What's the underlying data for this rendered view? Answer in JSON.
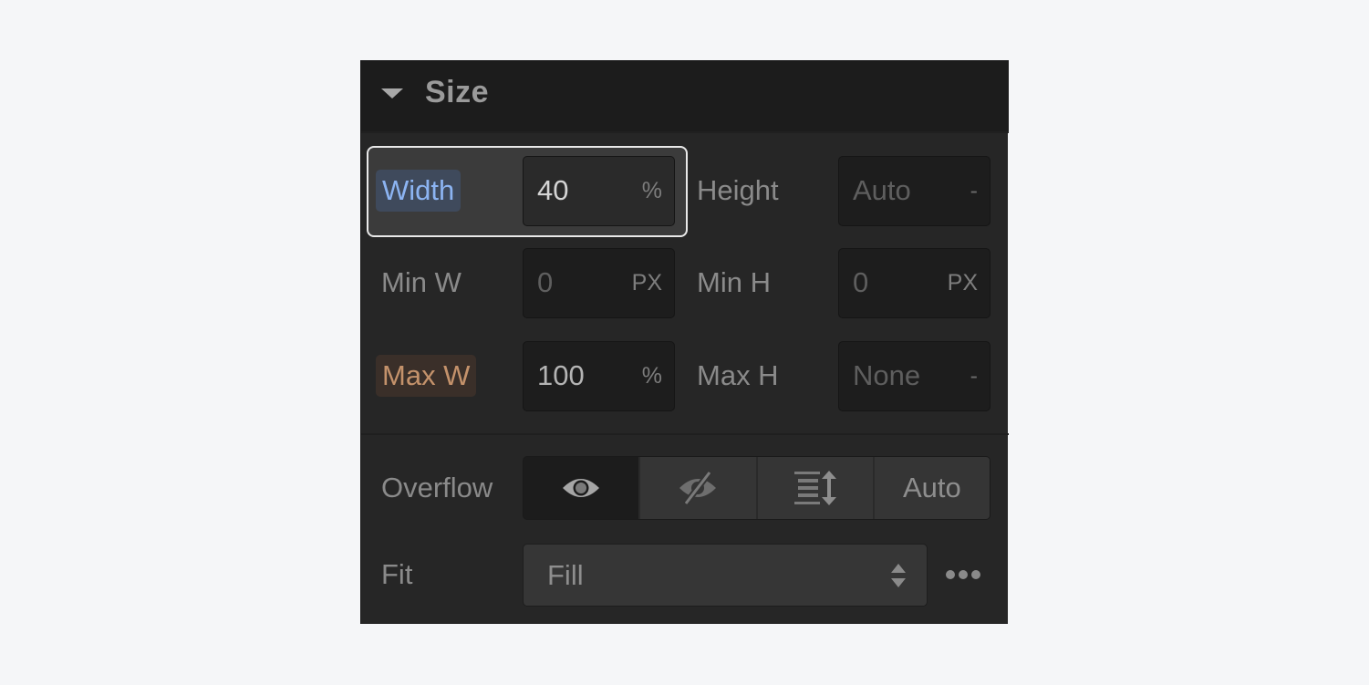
{
  "section": {
    "title": "Size",
    "expanded": true
  },
  "fields": {
    "width": {
      "label": "Width",
      "value": "40",
      "unit": "%",
      "state": "focused"
    },
    "height": {
      "label": "Height",
      "value": "Auto",
      "unit": "-",
      "state": "placeholder"
    },
    "min_w": {
      "label": "Min W",
      "value": "0",
      "unit": "PX",
      "state": "placeholder"
    },
    "min_h": {
      "label": "Min H",
      "value": "0",
      "unit": "PX",
      "state": "placeholder"
    },
    "max_w": {
      "label": "Max W",
      "value": "100",
      "unit": "%",
      "state": "set"
    },
    "max_h": {
      "label": "Max H",
      "value": "None",
      "unit": "-",
      "state": "placeholder"
    }
  },
  "overflow": {
    "label": "Overflow",
    "options": [
      {
        "icon": "eye-icon",
        "name": "Visible",
        "selected": true
      },
      {
        "icon": "eye-slash-icon",
        "name": "Hidden",
        "selected": false
      },
      {
        "icon": "scroll-icon",
        "name": "Scroll",
        "selected": false
      },
      {
        "text": "Auto",
        "name": "Auto",
        "selected": false
      }
    ]
  },
  "fit": {
    "label": "Fit",
    "selected": "Fill",
    "more_icon": "more-dots-icon"
  },
  "colors": {
    "width_highlight": "#8cb4f2",
    "max_w_highlight": "#c4926b"
  }
}
